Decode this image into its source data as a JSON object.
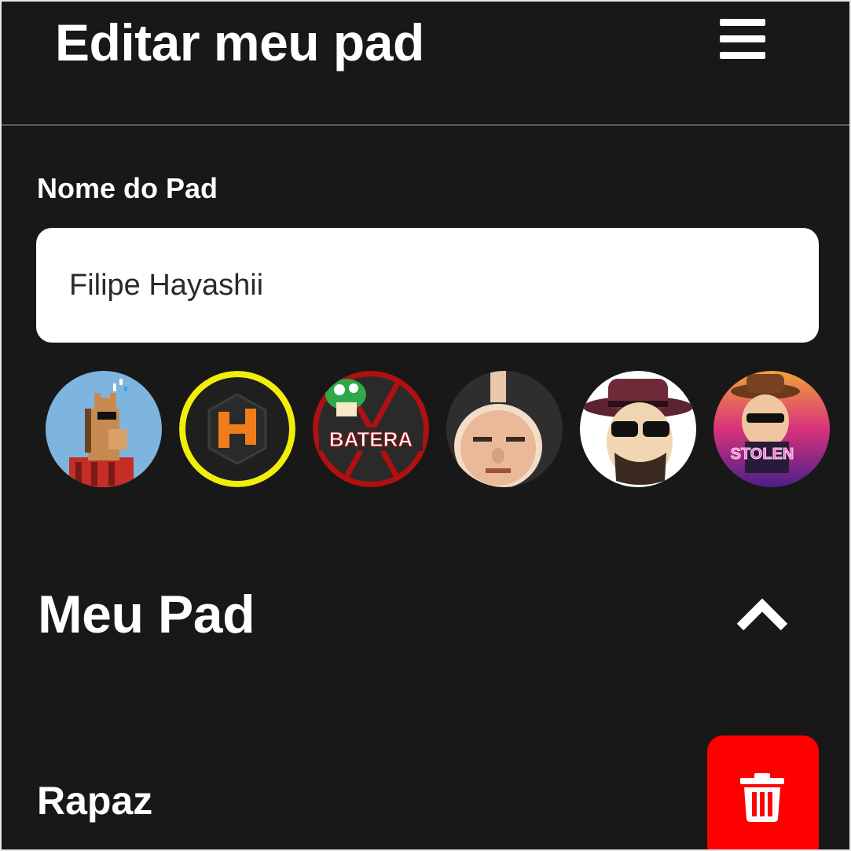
{
  "header": {
    "title": "Editar meu pad",
    "menu_icon": "hamburger-menu-icon"
  },
  "form": {
    "name_label": "Nome do Pad",
    "name_value": "Filipe Hayashii"
  },
  "avatars": [
    {
      "id": "avatar-horse",
      "text": ""
    },
    {
      "id": "avatar-h-logo",
      "text": ""
    },
    {
      "id": "avatar-batera",
      "text": "BATERA"
    },
    {
      "id": "avatar-face",
      "text": ""
    },
    {
      "id": "avatar-cowboy",
      "text": ""
    },
    {
      "id": "avatar-stolen",
      "text": "STOLEN"
    }
  ],
  "section": {
    "title": "Meu Pad",
    "toggle_icon": "chevron-up-icon"
  },
  "sounds": [
    {
      "label": "Rapaz",
      "delete_icon": "trash-icon"
    }
  ],
  "colors": {
    "background": "#181818",
    "text": "#ffffff",
    "delete": "#ff0000",
    "divider": "#5a5a5a"
  }
}
